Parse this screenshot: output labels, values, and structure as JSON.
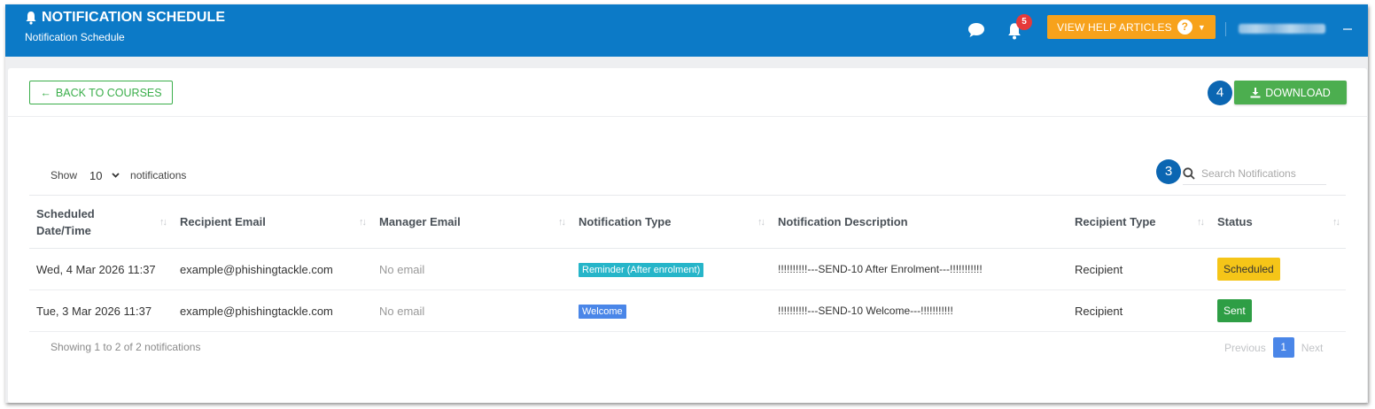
{
  "header": {
    "title": "NOTIFICATION SCHEDULE",
    "subtitle": "Notification Schedule",
    "notification_count": "5",
    "help_label": "VIEW HELP ARTICLES",
    "help_q": "?",
    "colors": {
      "header_bg": "#0c7ac7",
      "help_bg": "#f7a21b",
      "badge_bg": "#e53a3a"
    }
  },
  "toolbar": {
    "back_label": "BACK TO COURSES",
    "download_label": "DOWNLOAD",
    "download_step": "4",
    "search_step": "3"
  },
  "table_controls": {
    "show_label": "Show",
    "length_value": "10",
    "length_suffix": "notifications",
    "search_placeholder": "Search Notifications"
  },
  "table": {
    "columns": [
      "Scheduled Date/Time",
      "Recipient Email",
      "Manager Email",
      "Notification Type",
      "Notification Description",
      "Recipient Type",
      "Status"
    ],
    "rows": [
      {
        "date": "Wed, 4 Mar 2026 11:37",
        "recipient_email": "example@phishingtackle.com",
        "manager_email": "No email",
        "type": "Reminder (After enrolment)",
        "description": "!!!!!!!!!!---SEND-10 After Enrolment---!!!!!!!!!!!",
        "recipient_type": "Recipient",
        "status": "Scheduled"
      },
      {
        "date": "Tue, 3 Mar 2026 11:37",
        "recipient_email": "example@phishingtackle.com",
        "manager_email": "No email",
        "type": "Welcome",
        "description": "!!!!!!!!!!---SEND-10 Welcome---!!!!!!!!!!!",
        "recipient_type": "Recipient",
        "status": "Sent"
      }
    ]
  },
  "footer": {
    "info": "Showing 1 to 2 of 2 notifications",
    "previous": "Previous",
    "current_page": "1",
    "next": "Next"
  },
  "colors": {
    "success": "#4cae4f",
    "step_badge": "#0b66b2",
    "tag_reminder": "#26b5c9",
    "tag_welcome": "#4a86e8",
    "status_scheduled": "#f5c518",
    "status_sent": "#2e9e45"
  }
}
